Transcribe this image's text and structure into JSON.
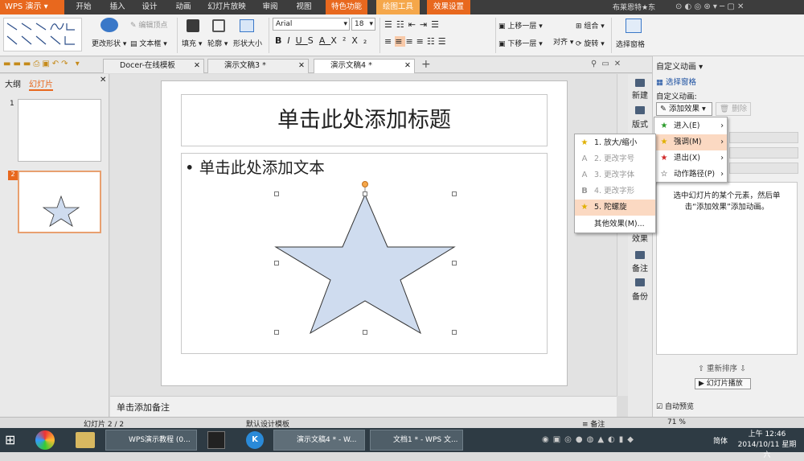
{
  "app": {
    "name": "WPS 演示"
  },
  "menu_tabs": [
    "开始",
    "插入",
    "设计",
    "动画",
    "幻灯片放映",
    "审阅",
    "视图",
    "特色功能",
    "绘图工具",
    "效果设置"
  ],
  "user": "布莱恩特★东",
  "ribbon": {
    "edit_vertex": "编辑顶点",
    "change_shape": "更改形状",
    "textbox": "文本框",
    "fill": "填充",
    "outline": "轮廓",
    "shape_size": "形状大小",
    "font_name": "Arial",
    "font_size": "18",
    "bring_forward": "上移一层",
    "send_backward": "下移一层",
    "group": "组合",
    "align": "对齐",
    "rotate": "旋转",
    "selection_pane": "选择窗格"
  },
  "doc_tabs": [
    "Docer-在线模板",
    "演示文稿3 *",
    "演示文稿4 *"
  ],
  "left_panel": {
    "tabs": [
      "大纲",
      "幻灯片"
    ],
    "slides": [
      "1",
      "2"
    ]
  },
  "slide": {
    "title_placeholder": "单击此处添加标题",
    "body_placeholder": "单击此处添加文本"
  },
  "notes_placeholder": "单击添加备注",
  "vertical_tools": [
    "新建",
    "版式",
    "效果",
    "备注",
    "备份"
  ],
  "animation_panel": {
    "title": "自定义动画",
    "selection_pane": "选择窗格",
    "custom_anim_label": "自定义动画:",
    "add_effect": "添加效果",
    "delete": "删除",
    "hint": "选中幻灯片的某个元素，然后单击“添加效果”添加动画。",
    "reorder": "重新排序",
    "slideshow": "幻灯片播放",
    "autopreview": "自动预览"
  },
  "effect_menu": [
    {
      "label": "进入(E)",
      "icon": "green-star-icon"
    },
    {
      "label": "强调(M)",
      "icon": "yellow-star-icon"
    },
    {
      "label": "退出(X)",
      "icon": "red-star-icon"
    },
    {
      "label": "动作路径(P)",
      "icon": "outline-star-icon"
    }
  ],
  "emphasis_submenu": [
    {
      "label": "1. 放大/缩小",
      "enabled": true
    },
    {
      "label": "2. 更改字号",
      "enabled": false
    },
    {
      "label": "3. 更改字体",
      "enabled": false
    },
    {
      "label": "4. 更改字形",
      "enabled": false
    },
    {
      "label": "5. 陀螺旋",
      "enabled": true
    },
    {
      "label": "其他效果(M)...",
      "enabled": true
    }
  ],
  "status": {
    "slide_count": "幻灯片 2 / 2",
    "template": "默认设计模板",
    "notes": "备注",
    "zoom": "71 %"
  },
  "taskbar": {
    "items": [
      "WPS演示教程 (0...",
      "演示文稿4 * - W...",
      "文档1 * - WPS 文..."
    ],
    "ime": "简体",
    "time": "上午 12:46",
    "date": "2014/10/11 星期六"
  },
  "colors": {
    "accent": "#e8681e",
    "star_fill": "#cfdcef",
    "highlight": "#fbd9c2"
  }
}
